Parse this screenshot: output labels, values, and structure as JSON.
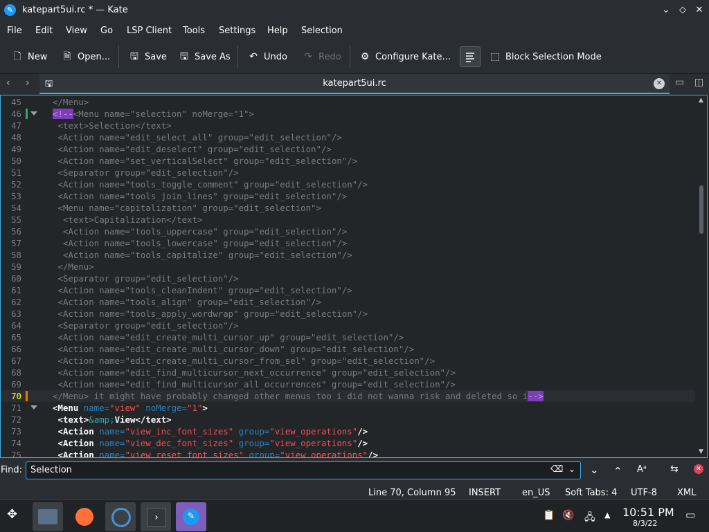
{
  "window": {
    "title": "katepart5ui.rc * — Kate"
  },
  "menu": [
    "File",
    "Edit",
    "View",
    "Go",
    "LSP Client",
    "Tools",
    "Settings",
    "Help",
    "Selection"
  ],
  "toolbar": {
    "new": "New",
    "open": "Open...",
    "save": "Save",
    "save_as": "Save As",
    "undo": "Undo",
    "redo": "Redo",
    "configure": "Configure Kate...",
    "block_selection": "Block Selection Mode"
  },
  "tab": {
    "label": "katepart5ui.rc"
  },
  "editor": {
    "lines": [
      {
        "n": "45",
        "parts": [
          [
            "c",
            "</Menu>"
          ]
        ],
        "indent": 0
      },
      {
        "n": "46",
        "parts": [
          [
            "h",
            "<!--"
          ],
          [
            "c",
            "<Menu name=\"selection\" noMerge=\"1\">"
          ]
        ],
        "indent": 0,
        "marker": "#27ae60",
        "fold": true
      },
      {
        "n": "47",
        "parts": [
          [
            "c",
            "<text>Selection</text>"
          ]
        ],
        "indent": 1
      },
      {
        "n": "48",
        "parts": [
          [
            "c",
            "<Action name=\"edit_select_all\" group=\"edit_selection\"/>"
          ]
        ],
        "indent": 1
      },
      {
        "n": "49",
        "parts": [
          [
            "c",
            "<Action name=\"edit_deselect\" group=\"edit_selection\"/>"
          ]
        ],
        "indent": 1
      },
      {
        "n": "50",
        "parts": [
          [
            "c",
            "<Action name=\"set_verticalSelect\" group=\"edit_selection\"/>"
          ]
        ],
        "indent": 1
      },
      {
        "n": "51",
        "parts": [
          [
            "c",
            "<Separator group=\"edit_selection\"/>"
          ]
        ],
        "indent": 1
      },
      {
        "n": "52",
        "parts": [
          [
            "c",
            "<Action name=\"tools_toggle_comment\" group=\"edit_selection\"/>"
          ]
        ],
        "indent": 1
      },
      {
        "n": "53",
        "parts": [
          [
            "c",
            "<Action name=\"tools_join_lines\" group=\"edit_selection\"/>"
          ]
        ],
        "indent": 1
      },
      {
        "n": "54",
        "parts": [
          [
            "c",
            "<Menu name=\"capitalization\" group=\"edit_selection\">"
          ]
        ],
        "indent": 1
      },
      {
        "n": "55",
        "parts": [
          [
            "c",
            "<text>Capitalization</text>"
          ]
        ],
        "indent": 2
      },
      {
        "n": "56",
        "parts": [
          [
            "c",
            "<Action name=\"tools_uppercase\" group=\"edit_selection\"/>"
          ]
        ],
        "indent": 2
      },
      {
        "n": "57",
        "parts": [
          [
            "c",
            "<Action name=\"tools_lowercase\" group=\"edit_selection\"/>"
          ]
        ],
        "indent": 2
      },
      {
        "n": "58",
        "parts": [
          [
            "c",
            "<Action name=\"tools_capitalize\" group=\"edit_selection\"/>"
          ]
        ],
        "indent": 2
      },
      {
        "n": "59",
        "parts": [
          [
            "c",
            "</Menu>"
          ]
        ],
        "indent": 1
      },
      {
        "n": "60",
        "parts": [
          [
            "c",
            "<Separator group=\"edit_selection\"/>"
          ]
        ],
        "indent": 1
      },
      {
        "n": "61",
        "parts": [
          [
            "c",
            "<Action name=\"tools_cleanIndent\" group=\"edit_selection\"/>"
          ]
        ],
        "indent": 1
      },
      {
        "n": "62",
        "parts": [
          [
            "c",
            "<Action name=\"tools_align\" group=\"edit_selection\"/>"
          ]
        ],
        "indent": 1
      },
      {
        "n": "63",
        "parts": [
          [
            "c",
            "<Action name=\"tools_apply_wordwrap\" group=\"edit_selection\"/>"
          ]
        ],
        "indent": 1
      },
      {
        "n": "64",
        "parts": [
          [
            "c",
            "<Separator group=\"edit_selection\"/>"
          ]
        ],
        "indent": 1
      },
      {
        "n": "65",
        "parts": [
          [
            "c",
            "<Action name=\"edit_create_multi_cursor_up\" group=\"edit_selection\"/>"
          ]
        ],
        "indent": 1
      },
      {
        "n": "66",
        "parts": [
          [
            "c",
            "<Action name=\"edit_create_multi_cursor_down\" group=\"edit_selection\"/>"
          ]
        ],
        "indent": 1
      },
      {
        "n": "67",
        "parts": [
          [
            "c",
            "<Action name=\"edit_create_multi_cursor_from_sel\" group=\"edit_selection\"/>"
          ]
        ],
        "indent": 1
      },
      {
        "n": "68",
        "parts": [
          [
            "c",
            "<Action name=\"edit_find_multicursor_next_occurrence\" group=\"edit_selection\"/>"
          ]
        ],
        "indent": 1
      },
      {
        "n": "69",
        "parts": [
          [
            "c",
            "<Action name=\"edit_find_multicursor_all_occurrences\" group=\"edit_selection\"/>"
          ]
        ],
        "indent": 1
      },
      {
        "n": "70",
        "parts": [
          [
            "c",
            "</Menu> it might have probably changed other menus too i did not wanna risk and deleted so i"
          ],
          [
            "h",
            "-->"
          ]
        ],
        "indent": 0,
        "marker": "#f67400",
        "current": true
      },
      {
        "n": "71",
        "parts": [
          [
            "t",
            "<Menu "
          ],
          [
            "a",
            "name="
          ],
          [
            "s",
            "\"view\""
          ],
          [
            "a",
            " noMerge="
          ],
          [
            "s",
            "\"1\""
          ],
          [
            "t",
            ">"
          ]
        ],
        "indent": 0,
        "fold": true
      },
      {
        "n": "72",
        "parts": [
          [
            "t",
            "<text>"
          ],
          [
            "e",
            "&amp;"
          ],
          [
            "t",
            "View</text>"
          ]
        ],
        "indent": 1
      },
      {
        "n": "73",
        "parts": [
          [
            "t",
            "<Action "
          ],
          [
            "a",
            "name="
          ],
          [
            "s",
            "\"view_inc_font_sizes\""
          ],
          [
            "a",
            " group="
          ],
          [
            "s",
            "\"view_operations\""
          ],
          [
            "t",
            "/>"
          ]
        ],
        "indent": 1
      },
      {
        "n": "74",
        "parts": [
          [
            "t",
            "<Action "
          ],
          [
            "a",
            "name="
          ],
          [
            "s",
            "\"view_dec_font_sizes\""
          ],
          [
            "a",
            " group="
          ],
          [
            "s",
            "\"view_operations\""
          ],
          [
            "t",
            "/>"
          ]
        ],
        "indent": 1
      },
      {
        "n": "75",
        "parts": [
          [
            "t",
            "<Action "
          ],
          [
            "a",
            "name="
          ],
          [
            "s",
            "\"view_reset_font_sizes\""
          ],
          [
            "a",
            " group="
          ],
          [
            "s",
            "\"view_operations\""
          ],
          [
            "t",
            "/>"
          ]
        ],
        "indent": 1
      }
    ]
  },
  "find": {
    "label": "Find:",
    "value": "Selection"
  },
  "status": {
    "position": "Line 70, Column 95",
    "mode": "INSERT",
    "language": "en_US",
    "indent": "Soft Tabs: 4",
    "encoding": "UTF-8",
    "syntax": "XML"
  },
  "taskbar": {
    "time": "10:51 PM",
    "date": "8/3/22"
  }
}
